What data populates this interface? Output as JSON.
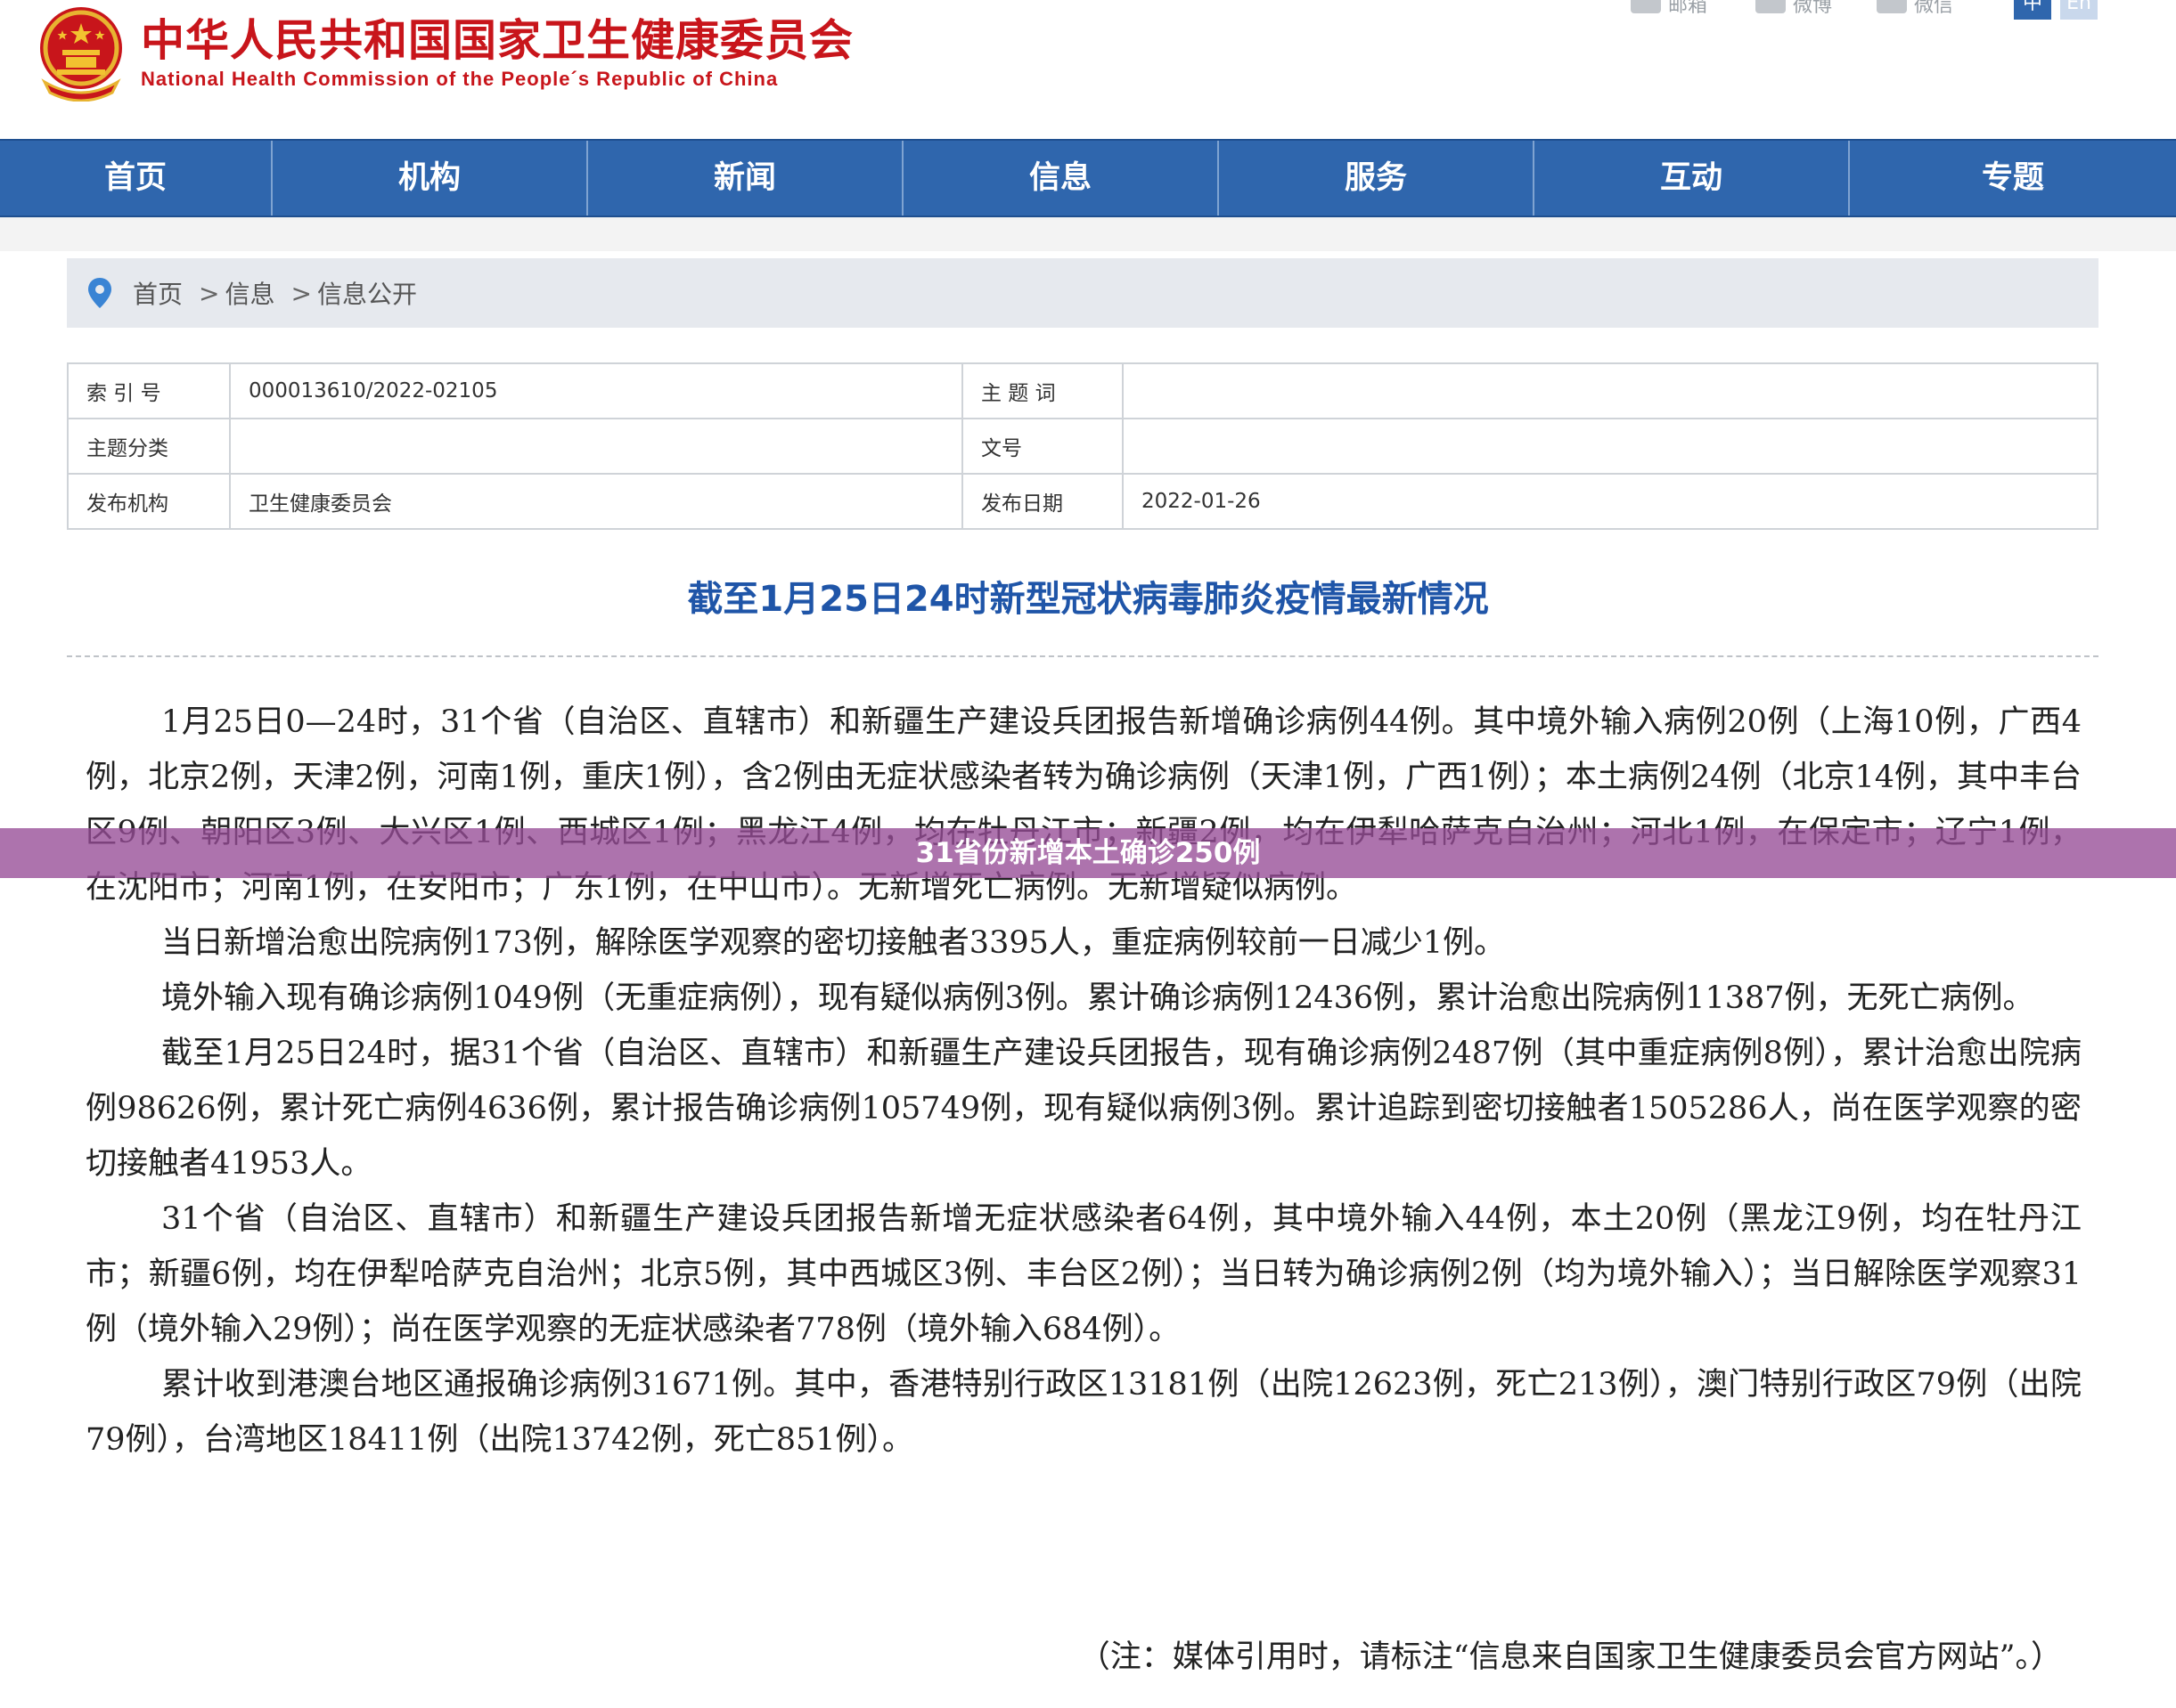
{
  "header": {
    "site_title": "中华人民共和国国家卫生健康委员会",
    "site_subtitle": "National Health Commission of the People´s Republic of China",
    "share": [
      {
        "label": "邮箱",
        "icon": "mail-icon"
      },
      {
        "label": "微博",
        "icon": "weibo-icon"
      },
      {
        "label": "微信",
        "icon": "wechat-icon"
      }
    ],
    "lang": [
      "中",
      "En"
    ]
  },
  "nav": {
    "items": [
      "首页",
      "机构",
      "新闻",
      "信息",
      "服务",
      "互动",
      "专题"
    ]
  },
  "breadcrumb": {
    "items": [
      "首页",
      "信息",
      "信息公开"
    ],
    "separator": ">"
  },
  "meta": {
    "index_label": "索 引 号",
    "index_value": "000013610/2022-02105",
    "keyword_label": "主 题 词",
    "keyword_value": "",
    "category_label": "主题分类",
    "category_value": "",
    "doc_no_label": "文号",
    "doc_no_value": "",
    "publisher_label": "发布机构",
    "publisher_value": "卫生健康委员会",
    "date_label": "发布日期",
    "date_value": "2022-01-26"
  },
  "article": {
    "title": "截至1月25日24时新型冠状病毒肺炎疫情最新情况",
    "paragraphs": [
      "1月25日0—24时，31个省（自治区、直辖市）和新疆生产建设兵团报告新增确诊病例44例。其中境外输入病例20例（上海10例，广西4例，北京2例，天津2例，河南1例，重庆1例），含2例由无症状感染者转为确诊病例（天津1例，广西1例）；本土病例24例（北京14例，其中丰台区9例、朝阳区3例、大兴区1例、西城区1例；黑龙江4例，均在牡丹江市；新疆2例，均在伊犁哈萨克自治州；河北1例，在保定市；辽宁1例，在沈阳市；河南1例，在安阳市；广东1例，在中山市）。无新增死亡病例。无新增疑似病例。",
      "当日新增治愈出院病例173例，解除医学观察的密切接触者3395人，重症病例较前一日减少1例。",
      "境外输入现有确诊病例1049例（无重症病例），现有疑似病例3例。累计确诊病例12436例，累计治愈出院病例11387例，无死亡病例。",
      "截至1月25日24时，据31个省（自治区、直辖市）和新疆生产建设兵团报告，现有确诊病例2487例（其中重症病例8例），累计治愈出院病例98626例，累计死亡病例4636例，累计报告确诊病例105749例，现有疑似病例3例。累计追踪到密切接触者1505286人，尚在医学观察的密切接触者41953人。",
      "31个省（自治区、直辖市）和新疆生产建设兵团报告新增无症状感染者64例，其中境外输入44例，本土20例（黑龙江9例，均在牡丹江市；新疆6例，均在伊犁哈萨克自治州；北京5例，其中西城区3例、丰台区2例）；当日转为确诊病例2例（均为境外输入）；当日解除医学观察31例（境外输入29例）；尚在医学观察的无症状感染者778例（境外输入684例）。",
      "累计收到港澳台地区通报确诊病例31671例。其中，香港特别行政区13181例（出院12623例，死亡213例），澳门特别行政区79例（出院79例），台湾地区18411例（出院13742例，死亡851例）。"
    ],
    "note": "（注：媒体引用时，请标注“信息来自国家卫生健康委员会官方网站”。）"
  },
  "overlay_banner": "31省份新增本土确诊250例",
  "colors": {
    "brand_red": "#c8151b",
    "nav_blue": "#2f66ad",
    "title_blue": "#1f55a8",
    "banner": "#964c96"
  }
}
